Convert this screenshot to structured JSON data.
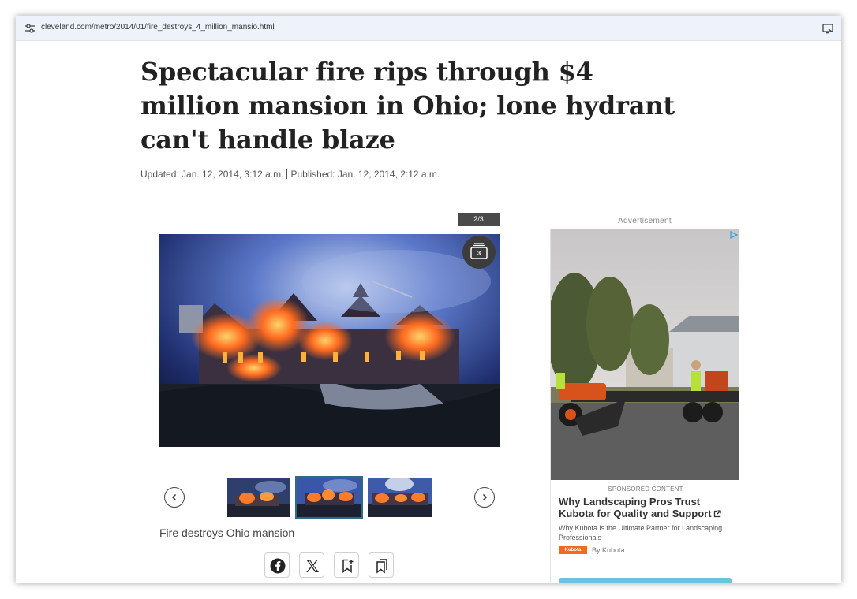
{
  "browser": {
    "url": "cleveland.com/metro/2014/01/fire_destroys_4_million_mansio.html",
    "icons": [
      "tune-icon",
      "cast-icon"
    ]
  },
  "article": {
    "headline": "Spectacular fire rips through $4 million mansion in Ohio; lone hydrant can't handle blaze",
    "updated": "Updated: Jan. 12, 2014, 3:12 a.m.",
    "published": "Published: Jan. 12, 2014, 2:12 a.m."
  },
  "gallery": {
    "counter": "2/3",
    "photo_count": "3",
    "caption": "Fire destroys Ohio mansion",
    "selected_thumb": 1,
    "thumbnails": 3
  },
  "share": {
    "icons": [
      "facebook-icon",
      "x-icon",
      "bookmark-add-icon",
      "bookmarks-icon"
    ]
  },
  "ad": {
    "label": "Advertisement",
    "sponsored": "SPONSORED CONTENT",
    "title": "Why Landscaping Pros Trust Kubota for Quality and Support",
    "description": "Why Kubota is the Ultimate Partner for Landscaping Professionals",
    "brand_logo": "Kubota",
    "brand": "By Kubota",
    "cta_color": "#6cc3dc",
    "brand_color": "#f26b1d"
  }
}
